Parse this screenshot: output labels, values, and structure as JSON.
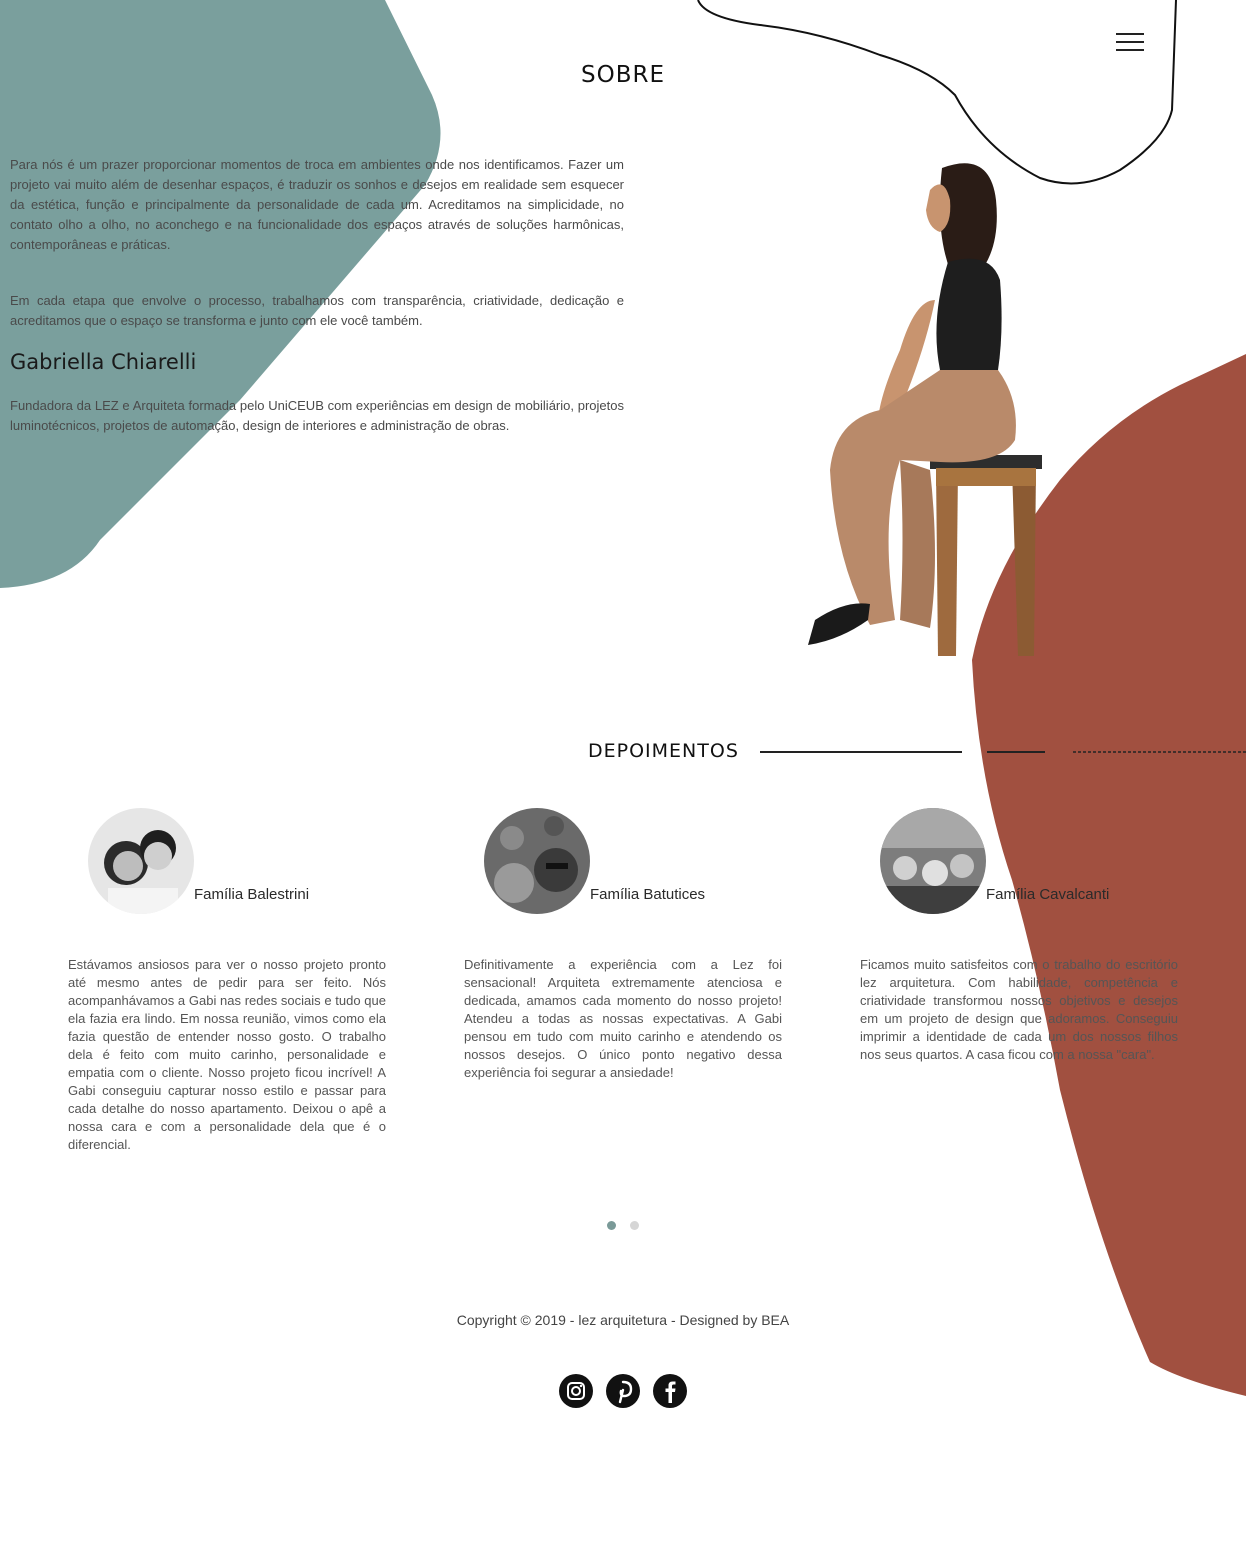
{
  "colors": {
    "teal_shape": "#7a9f9d",
    "rust_shape": "#a15040",
    "skin": "#c8946f",
    "pants": "#b98a6a",
    "wood": "#9e6a3e"
  },
  "header": {
    "menu_icon": "hamburger-menu-icon"
  },
  "about": {
    "title": "SOBRE",
    "paragraph_1": "Para nós é um prazer proporcionar momentos de troca em ambientes onde nos identificamos. Fazer um projeto vai muito além de desenhar espaços, é traduzir os sonhos e desejos em realidade sem esquecer da estética, função e principalmente da personalidade de cada um. Acreditamos na simplicidade, no contato olho a olho, no aconchego e na funcionalidade dos espaços através de soluções harmônicas, contemporâneas e práticas.",
    "paragraph_2": "Em cada etapa que envolve o processo, trabalhamos com transparência, criatividade, dedicação e acreditamos que o espaço se transforma e junto com ele você também.",
    "founder_name": "Gabriella Chiarelli",
    "founder_bio": "Fundadora da LEZ e Arquiteta formada pelo UniCEUB com experiências em design de mobiliário, projetos luminotécnicos, projetos de automação, design de interiores e administração de obras."
  },
  "testimonials": {
    "title": "DEPOIMENTOS",
    "items": [
      {
        "name": "Família Balestrini",
        "text": "Estávamos ansiosos para ver o nosso projeto pronto até mesmo antes de pedir para ser feito. Nós acompanhávamos a Gabi nas redes sociais e tudo que ela fazia era lindo. Em nossa reunião, vimos como ela fazia questão de entender nosso gosto. O trabalho dela é feito com muito carinho, personalidade e empatia com o cliente. Nosso projeto ficou incrível! A Gabi conseguiu capturar nosso estilo e passar para cada detalhe do nosso apartamento. Deixou o apê a nossa cara e com a personalidade dela que é o diferencial."
      },
      {
        "name": "Família Batutices",
        "text": "Definitivamente a experiência com a Lez foi sensacional! Arquiteta extremamente atenciosa e dedicada, amamos cada momento do nosso projeto! Atendeu a todas as nossas expectativas. A Gabi pensou em tudo com muito carinho e atendendo os nossos desejos. O único ponto negativo dessa experiência foi segurar a ansiedade!"
      },
      {
        "name": "Família Cavalcanti",
        "text": "Ficamos muito satisfeitos com o trabalho do escritório lez arquitetura. Com habilidade, competência e criatividade transformou nossos objetivos e desejos em um projeto de design que adoramos. Conseguiu imprimir a identidade de cada um dos nossos filhos nos seus quartos. A casa ficou com a nossa \"cara\"."
      }
    ],
    "pagination": {
      "active": 1,
      "total": 2
    }
  },
  "footer": {
    "copyright": "Copyright © 2019 - lez arquitetura - Designed by BEA",
    "social": [
      "instagram-icon",
      "pinterest-icon",
      "facebook-icon"
    ]
  }
}
